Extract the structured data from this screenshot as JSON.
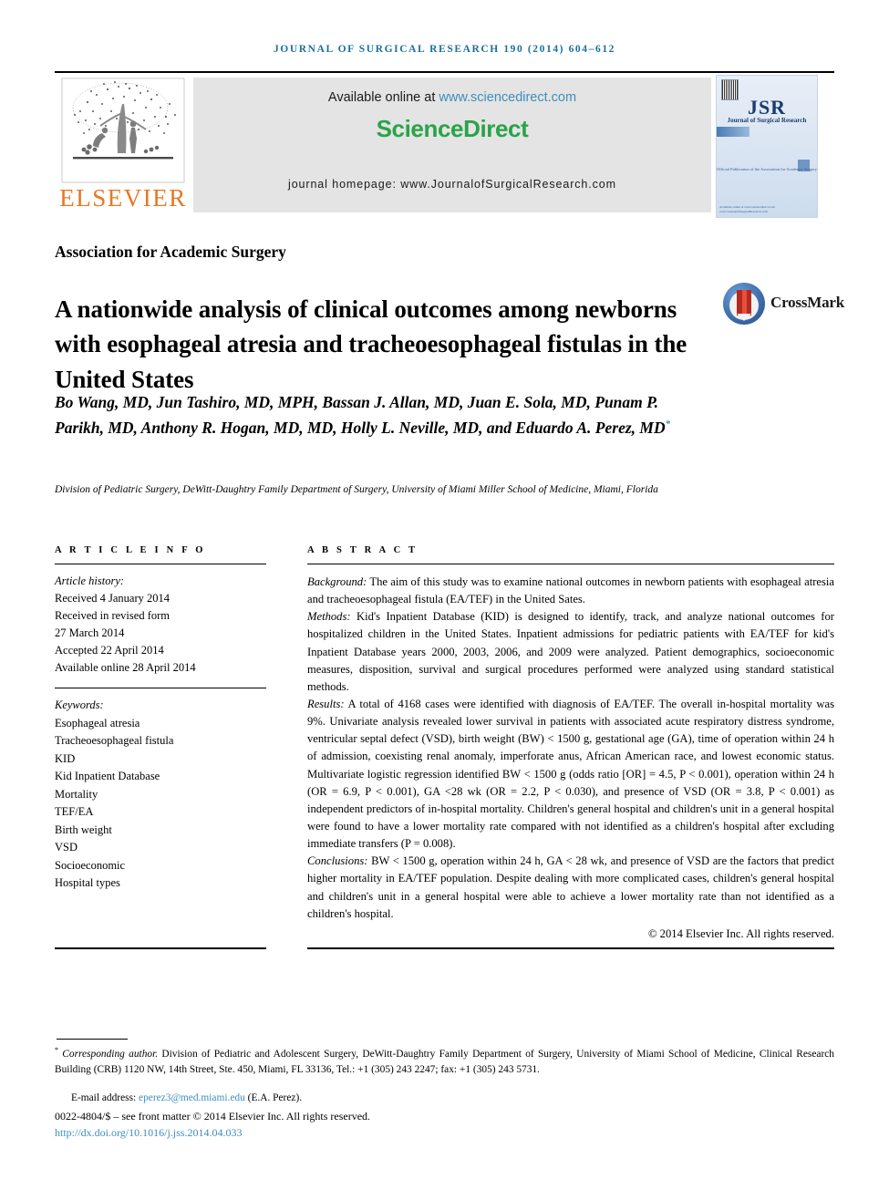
{
  "running_head": "JOURNAL OF SURGICAL RESEARCH 190 (2014) 604–612",
  "masthead": {
    "publisher_name": "ELSEVIER",
    "available_prefix": "Available online at ",
    "available_url": "www.sciencedirect.com",
    "sciencedirect_logo": "ScienceDirect",
    "homepage_line": "journal homepage: www.JournalofSurgicalResearch.com",
    "cover": {
      "title": "JSR",
      "subtitle": "Journal of Surgical Research",
      "footline": "Official Publication of the Association for Academic Surgery",
      "tiny": "Available online at www.sciencedirect.com  www.JournalofSurgicalResearch.com"
    }
  },
  "society_line": "Association for Academic Surgery",
  "article_title": "A nationwide analysis of clinical outcomes among newborns with esophageal atresia and tracheoesophageal fistulas in the United States",
  "crossmark_label": "CrossMark",
  "authors": "Bo Wang, MD, Jun Tashiro, MD, MPH, Bassan J. Allan, MD, Juan E. Sola, MD, Punam P. Parikh, MD, Anthony R. Hogan, MD, MD, Holly L. Neville, MD, and Eduardo A. Perez, MD",
  "author_marker": "*",
  "affiliation": "Division of Pediatric Surgery, DeWitt-Daughtry Family Department of Surgery, University of Miami Miller School of Medicine, Miami, Florida",
  "article_info": {
    "heading": "A R T I C L E   I N F O",
    "history_label": "Article history:",
    "history": [
      "Received 4 January 2014",
      "Received in revised form",
      "27 March 2014",
      "Accepted 22 April 2014",
      "Available online 28 April 2014"
    ],
    "keywords_label": "Keywords:",
    "keywords": [
      "Esophageal atresia",
      "Tracheoesophageal fistula",
      "KID",
      "Kid Inpatient Database",
      "Mortality",
      "TEF/EA",
      "Birth weight",
      "VSD",
      "Socioeconomic",
      "Hospital types"
    ]
  },
  "abstract": {
    "heading": "A B S T R A C T",
    "sections": [
      {
        "label": "Background:",
        "text": " The aim of this study was to examine national outcomes in newborn patients with esophageal atresia and tracheoesophageal fistula (EA/TEF) in the United Sates."
      },
      {
        "label": "Methods:",
        "text": " Kid's Inpatient Database (KID) is designed to identify, track, and analyze national outcomes for hospitalized children in the United States. Inpatient admissions for pediatric patients with EA/TEF for kid's Inpatient Database years 2000, 2003, 2006, and 2009 were analyzed. Patient demographics, socioeconomic measures, disposition, survival and surgical procedures performed were analyzed using standard statistical methods."
      },
      {
        "label": "Results:",
        "text": " A total of 4168 cases were identified with diagnosis of EA/TEF. The overall in-hospital mortality was 9%. Univariate analysis revealed lower survival in patients with associated acute respiratory distress syndrome, ventricular septal defect (VSD), birth weight (BW) < 1500 g, gestational age (GA), time of operation within 24 h of admission, coexisting renal anomaly, imperforate anus, African American race, and lowest economic status. Multivariate logistic regression identified BW < 1500 g (odds ratio [OR] = 4.5, P < 0.001), operation within 24 h (OR = 6.9, P < 0.001), GA <28 wk (OR = 2.2, P < 0.030), and presence of VSD (OR = 3.8, P < 0.001) as independent predictors of in-hospital mortality. Children's general hospital and children's unit in a general hospital were found to have a lower mortality rate compared with not identified as a children's hospital after excluding immediate transfers (P = 0.008)."
      },
      {
        "label": "Conclusions:",
        "text": " BW < 1500 g, operation within 24 h, GA < 28 wk, and presence of VSD are the factors that predict higher mortality in EA/TEF population. Despite dealing with more complicated cases, children's general hospital and children's unit in a general hospital were able to achieve a lower mortality rate than not identified as a children's hospital."
      }
    ],
    "copyright": "© 2014 Elsevier Inc. All rights reserved."
  },
  "footnotes": {
    "corresponding_marker": "*",
    "corresponding_label": "Corresponding author.",
    "corresponding_text": " Division of Pediatric and Adolescent Surgery, DeWitt-Daughtry Family Department of Surgery, University of Miami School of Medicine, Clinical Research Building (CRB) 1120 NW, 14th Street, Ste. 450, Miami, FL 33136, Tel.: +1 (305) 243 2247; fax: +1 (305) 243 5731.",
    "email_label": "E-mail address: ",
    "email": "eperez3@med.miami.edu",
    "email_attribution": " (E.A. Perez).",
    "issn_line": "0022-4804/$ – see front matter © 2014 Elsevier Inc. All rights reserved.",
    "doi": "http://dx.doi.org/10.1016/j.jss.2014.04.033"
  },
  "colors": {
    "running_head": "#1b6f9e",
    "link": "#3c8dbc",
    "sciencedirect_green": "#2aa348",
    "elsevier_orange": "#e87722",
    "banner_grey": "#e4e4e4"
  }
}
